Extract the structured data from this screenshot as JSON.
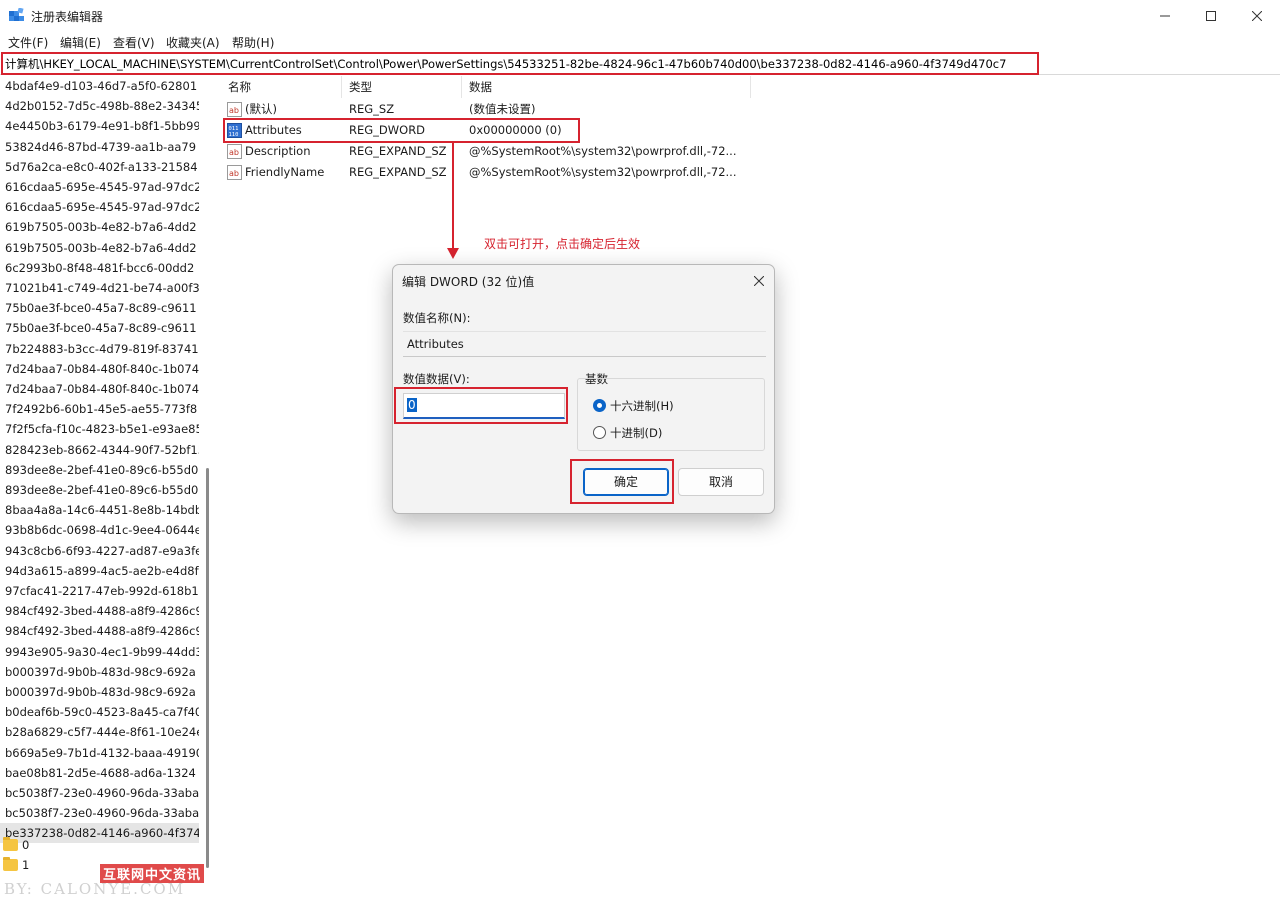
{
  "window": {
    "title": "注册表编辑器",
    "minimize": "—",
    "maximize": "☐",
    "close": "✕"
  },
  "menu": [
    "文件(F)",
    "编辑(E)",
    "查看(V)",
    "收藏夹(A)",
    "帮助(H)"
  ],
  "address": "计算机\\HKEY_LOCAL_MACHINE\\SYSTEM\\CurrentControlSet\\Control\\Power\\PowerSettings\\54533251-82be-4824-96c1-47b60b740d00\\be337238-0d82-4146-a960-4f3749d470c7",
  "tree": {
    "items": [
      "4bdaf4e9-d103-46d7-a5f0-62801",
      "4d2b0152-7d5c-498b-88e2-34345",
      "4e4450b3-6179-4e91-b8f1-5bb99",
      "53824d46-87bd-4739-aa1b-aa79",
      "5d76a2ca-e8c0-402f-a133-21584",
      "616cdaa5-695e-4545-97ad-97dc2",
      "616cdaa5-695e-4545-97ad-97dc2",
      "619b7505-003b-4e82-b7a6-4dd2",
      "619b7505-003b-4e82-b7a6-4dd2",
      "6c2993b0-8f48-481f-bcc6-00dd2",
      "71021b41-c749-4d21-be74-a00f3",
      "75b0ae3f-bce0-45a7-8c89-c9611",
      "75b0ae3f-bce0-45a7-8c89-c9611",
      "7b224883-b3cc-4d79-819f-83741",
      "7d24baa7-0b84-480f-840c-1b074",
      "7d24baa7-0b84-480f-840c-1b074",
      "7f2492b6-60b1-45e5-ae55-773f8",
      "7f2f5cfa-f10c-4823-b5e1-e93ae85",
      "828423eb-8662-4344-90f7-52bf15",
      "893dee8e-2bef-41e0-89c6-b55d0",
      "893dee8e-2bef-41e0-89c6-b55d0",
      "8baa4a8a-14c6-4451-8e8b-14bdb",
      "93b8b6dc-0698-4d1c-9ee4-0644e",
      "943c8cb6-6f93-4227-ad87-e9a3fe",
      "94d3a615-a899-4ac5-ae2b-e4d8f",
      "97cfac41-2217-47eb-992d-618b1",
      "984cf492-3bed-4488-a8f9-4286c9",
      "984cf492-3bed-4488-a8f9-4286c9",
      "9943e905-9a30-4ec1-9b99-44dd3",
      "b000397d-9b0b-483d-98c9-692a",
      "b000397d-9b0b-483d-98c9-692a",
      "b0deaf6b-59c0-4523-8a45-ca7f40",
      "b28a6829-c5f7-444e-8f61-10e24e",
      "b669a5e9-7b1d-4132-baaa-49190",
      "bae08b81-2d5e-4688-ad6a-1324",
      "bc5038f7-23e0-4960-96da-33aba",
      "bc5038f7-23e0-4960-96da-33aba",
      "be337238-0d82-4146-a960-4f374"
    ],
    "folders": [
      "0",
      "1"
    ]
  },
  "watermark": {
    "line1": "互联网中文资讯",
    "line2": "BY: CALONYE.COM"
  },
  "list": {
    "headers": {
      "name": "名称",
      "type": "类型",
      "data": "数据"
    },
    "rows": [
      {
        "name": "(默认)",
        "type": "REG_SZ",
        "data": "(数值未设置)",
        "icon": "ab-string-icon"
      },
      {
        "name": "Attributes",
        "type": "REG_DWORD",
        "data": "0x00000000 (0)",
        "icon": "binary-dword-icon"
      },
      {
        "name": "Description",
        "type": "REG_EXPAND_SZ",
        "data": "@%SystemRoot%\\system32\\powrprof.dll,-72...",
        "icon": "ab-string-icon"
      },
      {
        "name": "FriendlyName",
        "type": "REG_EXPAND_SZ",
        "data": "@%SystemRoot%\\system32\\powrprof.dll,-72...",
        "icon": "ab-string-icon"
      }
    ]
  },
  "annotation": {
    "text": "双击可打开，点击确定后生效",
    "color": "#d6232f"
  },
  "dialog": {
    "title": "编辑 DWORD (32 位)值",
    "close": "✕",
    "name_label": "数值名称(N):",
    "name_value": "Attributes",
    "data_label": "数值数据(V):",
    "data_value": "0",
    "base_label": "基数",
    "radio_hex": "十六进制(H)",
    "radio_dec": "十进制(D)",
    "selected_base": "hex",
    "ok": "确定",
    "cancel": "取消"
  },
  "colors": {
    "highlight": "#d6232f",
    "accent": "#0a64c8"
  }
}
